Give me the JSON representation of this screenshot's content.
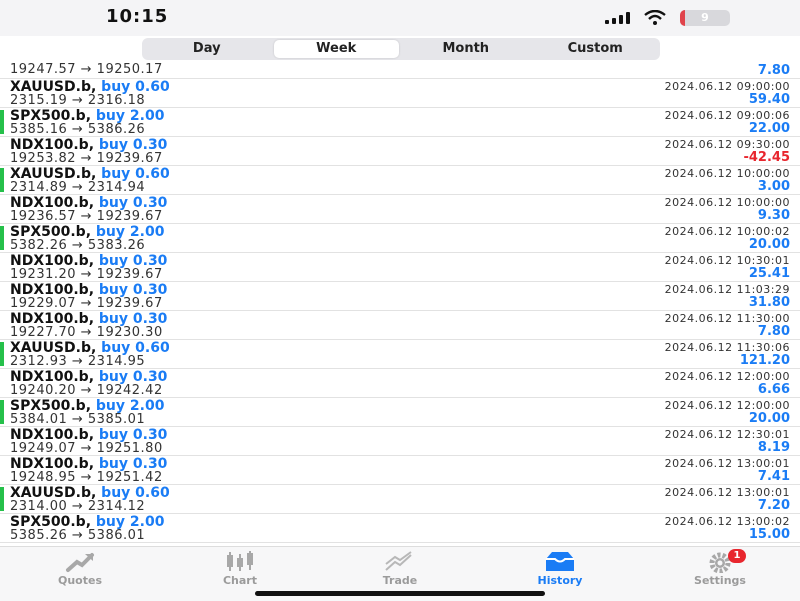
{
  "status": {
    "time": "10:15",
    "battery": "9",
    "battery_level": 0.09,
    "battery_color": "#e0434b"
  },
  "period_tabs": [
    {
      "label": "Day",
      "active": false
    },
    {
      "label": "Week",
      "active": true
    },
    {
      "label": "Month",
      "active": false
    },
    {
      "label": "Custom",
      "active": false
    }
  ],
  "colors": {
    "accent": "#1a7cf5",
    "negative": "#e8262e",
    "buy_marker": "#25c04a"
  },
  "trades": [
    {
      "symbol": "",
      "side": "",
      "prices": "19247.57 → 19250.17",
      "time": "",
      "profit": "7.80",
      "accent": false,
      "partial": true
    },
    {
      "symbol": "XAUUSD.b,",
      "side": "buy 0.60",
      "prices": "2315.19 → 2316.18",
      "time": "2024.06.12 09:00:00",
      "profit": "59.40",
      "accent": false
    },
    {
      "symbol": "SPX500.b,",
      "side": "buy 2.00",
      "prices": "5385.16 → 5386.26",
      "time": "2024.06.12 09:00:06",
      "profit": "22.00",
      "accent": true
    },
    {
      "symbol": "NDX100.b,",
      "side": "buy 0.30",
      "prices": "19253.82 → 19239.67",
      "time": "2024.06.12 09:30:00",
      "profit": "-42.45",
      "accent": false,
      "negative": true
    },
    {
      "symbol": "XAUUSD.b,",
      "side": "buy 0.60",
      "prices": "2314.89 → 2314.94",
      "time": "2024.06.12 10:00:00",
      "profit": "3.00",
      "accent": true
    },
    {
      "symbol": "NDX100.b,",
      "side": "buy 0.30",
      "prices": "19236.57 → 19239.67",
      "time": "2024.06.12 10:00:00",
      "profit": "9.30",
      "accent": false
    },
    {
      "symbol": "SPX500.b,",
      "side": "buy 2.00",
      "prices": "5382.26 → 5383.26",
      "time": "2024.06.12 10:00:02",
      "profit": "20.00",
      "accent": true
    },
    {
      "symbol": "NDX100.b,",
      "side": "buy 0.30",
      "prices": "19231.20 → 19239.67",
      "time": "2024.06.12 10:30:01",
      "profit": "25.41",
      "accent": false
    },
    {
      "symbol": "NDX100.b,",
      "side": "buy 0.30",
      "prices": "19229.07 → 19239.67",
      "time": "2024.06.12 11:03:29",
      "profit": "31.80",
      "accent": false
    },
    {
      "symbol": "NDX100.b,",
      "side": "buy 0.30",
      "prices": "19227.70 → 19230.30",
      "time": "2024.06.12 11:30:00",
      "profit": "7.80",
      "accent": false
    },
    {
      "symbol": "XAUUSD.b,",
      "side": "buy 0.60",
      "prices": "2312.93 → 2314.95",
      "time": "2024.06.12 11:30:06",
      "profit": "121.20",
      "accent": true
    },
    {
      "symbol": "NDX100.b,",
      "side": "buy 0.30",
      "prices": "19240.20 → 19242.42",
      "time": "2024.06.12 12:00:00",
      "profit": "6.66",
      "accent": false
    },
    {
      "symbol": "SPX500.b,",
      "side": "buy 2.00",
      "prices": "5384.01 → 5385.01",
      "time": "2024.06.12 12:00:00",
      "profit": "20.00",
      "accent": true
    },
    {
      "symbol": "NDX100.b,",
      "side": "buy 0.30",
      "prices": "19249.07 → 19251.80",
      "time": "2024.06.12 12:30:01",
      "profit": "8.19",
      "accent": false
    },
    {
      "symbol": "NDX100.b,",
      "side": "buy 0.30",
      "prices": "19248.95 → 19251.42",
      "time": "2024.06.12 13:00:01",
      "profit": "7.41",
      "accent": false
    },
    {
      "symbol": "XAUUSD.b,",
      "side": "buy 0.60",
      "prices": "2314.00 → 2314.12",
      "time": "2024.06.12 13:00:01",
      "profit": "7.20",
      "accent": true
    },
    {
      "symbol": "SPX500.b,",
      "side": "buy 2.00",
      "prices": "5385.26 → 5386.01",
      "time": "2024.06.12 13:00:02",
      "profit": "15.00",
      "accent": false
    }
  ],
  "tabbar": [
    {
      "label": "Quotes",
      "icon": "quotes-icon",
      "active": false
    },
    {
      "label": "Chart",
      "icon": "chart-icon",
      "active": false
    },
    {
      "label": "Trade",
      "icon": "trade-icon",
      "active": false
    },
    {
      "label": "History",
      "icon": "history-icon",
      "active": true
    },
    {
      "label": "Settings",
      "icon": "settings-icon",
      "active": false,
      "badge": "1"
    }
  ]
}
